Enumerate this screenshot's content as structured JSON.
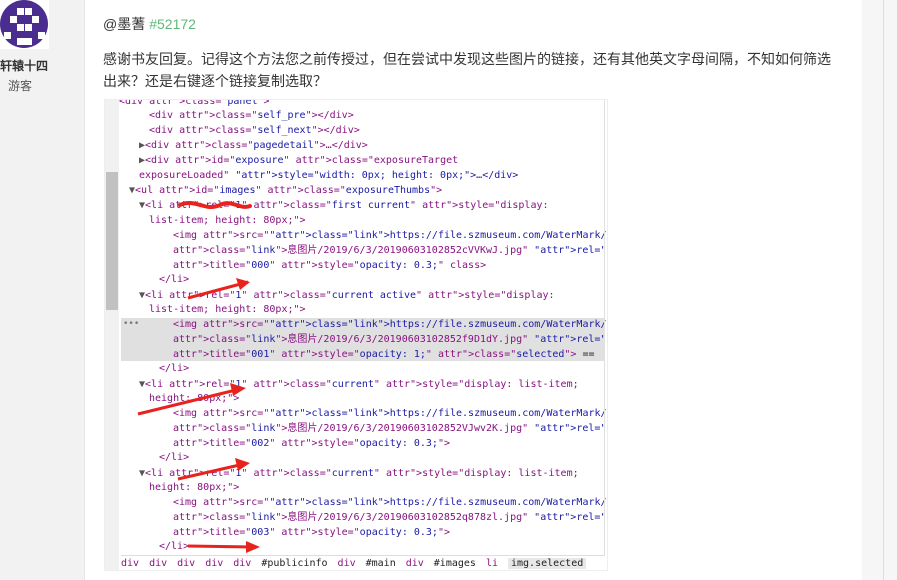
{
  "user": {
    "name": "轩辕十四",
    "role": "游客"
  },
  "post": {
    "mention_name": "@墨蓍",
    "mention_num": "#52172",
    "text": "感谢书友回复。记得这个方法您之前传授过，但在尝试中发现这些图片的链接，还有其他英文字母间隔，不知如何筛选出来？还是右键逐个链接复制选取？"
  },
  "devtools": {
    "lines": [
      {
        "t": "<div class=\"panel\">"
      },
      {
        "t": "<div class=\"self_pre\"></div>"
      },
      {
        "t": "<div class=\"self_next\"></div>"
      },
      {
        "t": "▶<div class=\"pagedetail\">…</div>"
      },
      {
        "t": "▶<div id=\"exposure\" class=\"exposureTarget"
      },
      {
        "t": "exposureLoaded\" style=\"width: 0px; height: 0px;\">…</div>"
      },
      {
        "t": "▼<ul id=\"images\" class=\"exposureThumbs\">"
      },
      {
        "t": "▼<li rel=\"1\" class=\"first current\" style=\"display:"
      },
      {
        "t": "list-item; height: 80px;\">"
      },
      {
        "t": "<img src=\"https://file.szmuseum.com/WaterMark/古籍信"
      },
      {
        "t": "息图片/2019/6/3/20190603102852cVVKwJ.jpg\" rel=\"0\""
      },
      {
        "t": "title=\"000\" style=\"opacity: 0.3;\" class>"
      },
      {
        "t": "</li>"
      },
      {
        "t": "▼<li rel=\"1\" class=\"current active\" style=\"display:"
      },
      {
        "t": "list-item; height: 80px;\">"
      },
      {
        "t": "<img src=\"https://file.szmuseum.com/WaterMark/古籍信"
      },
      {
        "t": "息图片/2019/6/3/20190603102852f9D1dY.jpg\" rel=\"1\""
      },
      {
        "t": "title=\"001\" style=\"opacity: 1;\" class=\"selected\"> =="
      },
      {
        "t": "</li>"
      },
      {
        "t": "▼<li rel=\"1\" class=\"current\" style=\"display: list-item;"
      },
      {
        "t": "height: 80px;\">"
      },
      {
        "t": "<img src=\"https://file.szmuseum.com/WaterMark/古籍信"
      },
      {
        "t": "息图片/2019/6/3/20190603102852VJwv2K.jpg\" rel=\"2\""
      },
      {
        "t": "title=\"002\" style=\"opacity: 0.3;\">"
      },
      {
        "t": "</li>"
      },
      {
        "t": "▼<li rel=\"1\" class=\"current\" style=\"display: list-item;"
      },
      {
        "t": "height: 80px;\">"
      },
      {
        "t": "<img src=\"https://file.szmuseum.com/WaterMark/古籍信"
      },
      {
        "t": "息图片/2019/6/3/20190603102852q878zl.jpg\" rel=\"3\""
      },
      {
        "t": "title=\"003\" style=\"opacity: 0.3;\">"
      },
      {
        "t": "</li>"
      }
    ],
    "dots": "•••",
    "breadcrumbs": [
      "div",
      "div",
      "div",
      "div",
      "div",
      "#publicinfo",
      "div",
      "#main",
      "div",
      "#images",
      "li",
      "img.selected"
    ]
  },
  "colors": {
    "accent_num": "#5fb878",
    "annotation": "#e8231e"
  }
}
